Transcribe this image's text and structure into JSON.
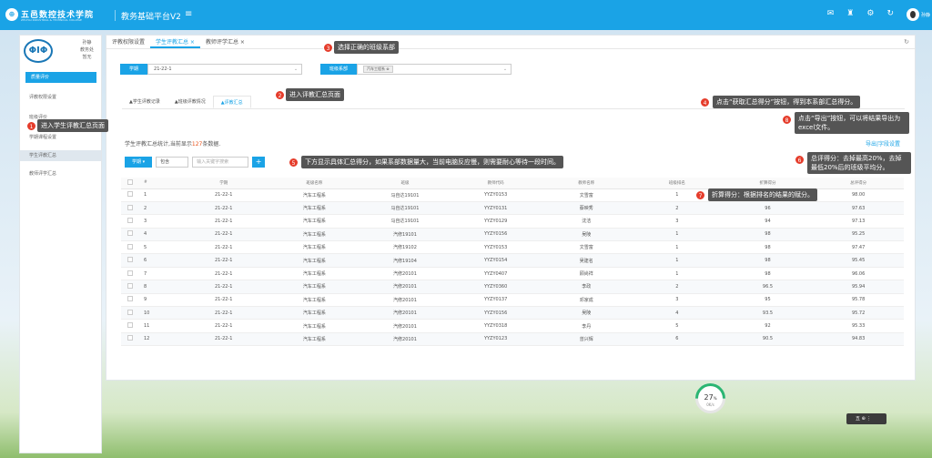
{
  "header": {
    "logo_glyph": "⊕",
    "school_name": "五邑数控技术学院",
    "school_sub": "ZHUHAI INDUSTRIAL & TECHNICAL COLLEGE",
    "platform": "教务基础平台V2",
    "menu_icon": "≡",
    "icons": [
      "mail-icon",
      "shirt-icon",
      "gear-icon",
      "refresh-icon"
    ],
    "icon_glyphs": [
      "✉",
      "♜",
      "⚙",
      "↻"
    ],
    "username": "孙静"
  },
  "sidebar": {
    "logo_text": "ΦIΦ",
    "user_lines": [
      "孙静",
      "教务处",
      "暂无"
    ],
    "group_label": "质量评价",
    "items": [
      {
        "label": "评教权限设置",
        "active": false
      },
      {
        "label": "班级评价",
        "active": false
      },
      {
        "label": "学期课程设置",
        "active": false
      },
      {
        "label": "学生评教汇总",
        "active": true
      },
      {
        "label": "教师评学汇总",
        "active": false
      }
    ]
  },
  "tabs": [
    {
      "label": "评教权限设置",
      "active": false
    },
    {
      "label": "学生评教汇总 ×",
      "active": true
    },
    {
      "label": "教师评学汇总 ×",
      "active": false
    }
  ],
  "filters": {
    "term_label": "学期",
    "term_value": "21-22-1",
    "dept_label": "班级系部",
    "dept_tag": "汽车工程系 ⊗"
  },
  "subtabs": [
    {
      "label": "▲学生评教记录",
      "active": false
    },
    {
      "label": "▲班级评教情况",
      "active": false
    },
    {
      "label": "▲评教汇总",
      "active": true
    }
  ],
  "summary": {
    "prefix": "学生评教汇总统计,当前显示",
    "count": "127",
    "suffix": "条数据."
  },
  "export_link": "导出|字段设置",
  "toolbar": {
    "term_btn": "学期 ▾",
    "select_value": "包含",
    "search_placeholder": "输入关键字搜索",
    "plus": "+"
  },
  "table": {
    "headers": [
      "",
      "#",
      "学期",
      "班级名称",
      "班级",
      "教师代码",
      "教师名称",
      "班级排名",
      "折算得分",
      "总评得分"
    ],
    "rows": [
      [
        "1",
        "21-22-1",
        "汽车工程系",
        "马自达19101",
        "YYZY0153",
        "文雪富",
        "1",
        "98",
        "98.00"
      ],
      [
        "2",
        "21-22-1",
        "汽车工程系",
        "马自达19101",
        "YYZY0131",
        "蔡映秀",
        "2",
        "96",
        "97.63"
      ],
      [
        "3",
        "21-22-1",
        "汽车工程系",
        "马自达19101",
        "YYZY0129",
        "沈洁",
        "3",
        "94",
        "97.13"
      ],
      [
        "4",
        "21-22-1",
        "汽车工程系",
        "汽修19101",
        "YYZY0156",
        "吴陵",
        "1",
        "98",
        "95.25"
      ],
      [
        "5",
        "21-22-1",
        "汽车工程系",
        "汽修19102",
        "YYZY0153",
        "文雪富",
        "1",
        "98",
        "97.47"
      ],
      [
        "6",
        "21-22-1",
        "汽车工程系",
        "汽修19104",
        "YYZY0154",
        "吴建名",
        "1",
        "98",
        "95.45"
      ],
      [
        "7",
        "21-22-1",
        "汽车工程系",
        "汽修20101",
        "YYZY0407",
        "顾尚祥",
        "1",
        "98",
        "96.06"
      ],
      [
        "8",
        "21-22-1",
        "汽车工程系",
        "汽修20101",
        "YYZY0360",
        "李政",
        "2",
        "96.5",
        "95.94"
      ],
      [
        "9",
        "21-22-1",
        "汽车工程系",
        "汽修20101",
        "YYZY0137",
        "邓家成",
        "3",
        "95",
        "95.78"
      ],
      [
        "10",
        "21-22-1",
        "汽车工程系",
        "汽修20101",
        "YYZY0156",
        "吴陵",
        "4",
        "93.5",
        "95.72"
      ],
      [
        "11",
        "21-22-1",
        "汽车工程系",
        "汽修20101",
        "YYZY0318",
        "李丹",
        "5",
        "92",
        "95.33"
      ],
      [
        "12",
        "21-22-1",
        "汽车工程系",
        "汽修20101",
        "YYZY0123",
        "曾兴辉",
        "6",
        "90.5",
        "94.83"
      ]
    ]
  },
  "callouts": [
    {
      "num": "1",
      "text": "进入学生评教汇总页面"
    },
    {
      "num": "2",
      "text": "进入评教汇总页面"
    },
    {
      "num": "3",
      "text": "选择正确的班级系部"
    },
    {
      "num": "4",
      "text": "点击“获取汇总得分”按钮，得到本系部汇总得分。"
    },
    {
      "num": "5",
      "text": "下方显示具体汇总得分，如果系部数据量大，当前电脑反应慢，则需要耐心等待一段时间。"
    },
    {
      "num": "6",
      "text": "总评得分：去掉最高20%，去掉最低20%后的班级平均分。"
    },
    {
      "num": "7",
      "text": "折算得分：根据排名的结果的赋分。"
    },
    {
      "num": "8",
      "text": "点击“导出”按钮，可以将结果导出为excel文件。"
    }
  ],
  "progress": {
    "value": "27",
    "unit": "%",
    "sub": "0K/s",
    "fraction": 0.27
  },
  "lang_widget": "五 ⊕ ⋮"
}
